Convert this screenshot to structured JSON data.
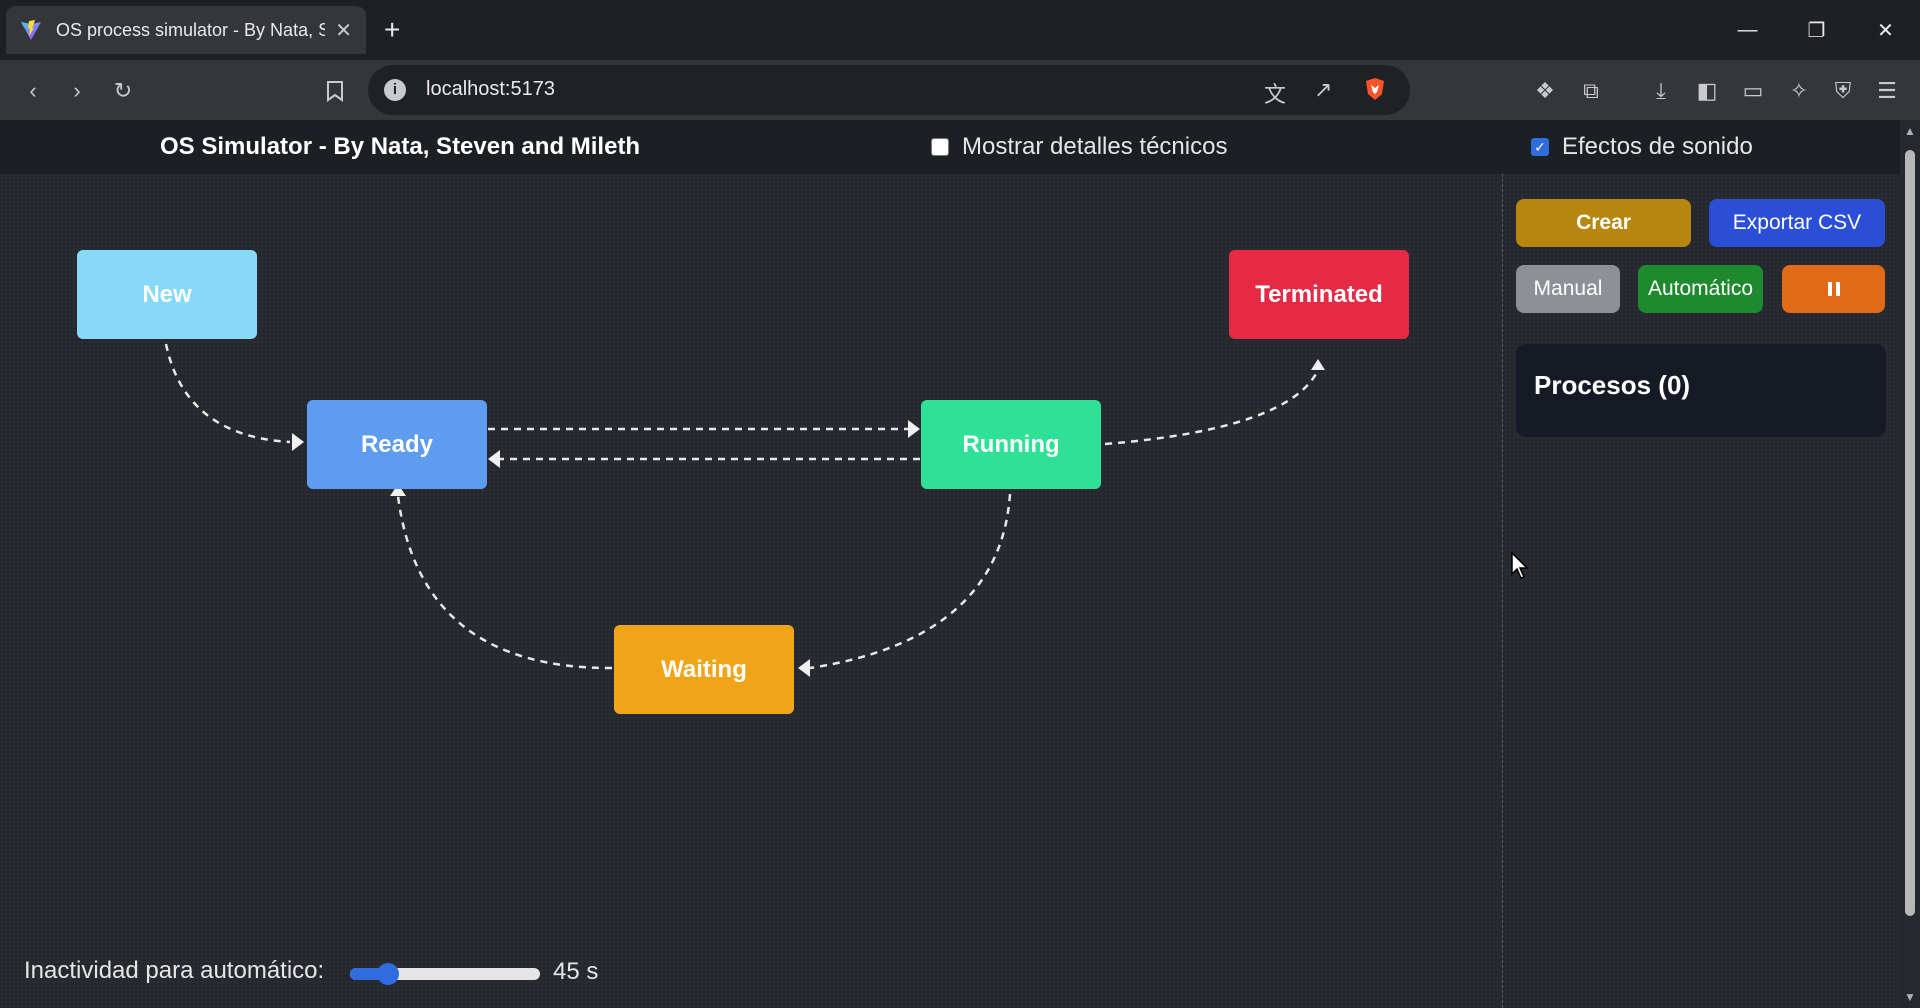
{
  "browser": {
    "tab_title": "OS process simulator - By Nata, S",
    "url": "localhost:5173",
    "new_tab_symbol": "+",
    "close_tab_symbol": "✕"
  },
  "header": {
    "title": "OS Simulator - By Nata, Steven and Mileth",
    "tech_details_label": "Mostrar detalles técnicos",
    "tech_details_checked": false,
    "sound_label": "Efectos de sonido",
    "sound_checked": true
  },
  "states": {
    "new": {
      "label": "New",
      "color": "#86d9f8"
    },
    "ready": {
      "label": "Ready",
      "color": "#5d9cee"
    },
    "running": {
      "label": "Running",
      "color": "#2fe097"
    },
    "waiting": {
      "label": "Waiting",
      "color": "#f0a417"
    },
    "terminated": {
      "label": "Terminated",
      "color": "#e62945"
    }
  },
  "controls": {
    "create_label": "Crear",
    "export_label": "Exportar CSV",
    "manual_label": "Manual",
    "auto_label": "Automático",
    "pause_icon": "pause-icon"
  },
  "processes": {
    "title": "Procesos (0)"
  },
  "idle": {
    "label": "Inactividad para automático:",
    "value_text": "45 s",
    "slider_fraction": 0.2
  },
  "colors": {
    "create": "#b7860f",
    "export": "#2a4fd6",
    "manual": "#8d9097",
    "auto": "#1e8a2d",
    "pause": "#e06a18",
    "accent": "#2f6ddf"
  }
}
